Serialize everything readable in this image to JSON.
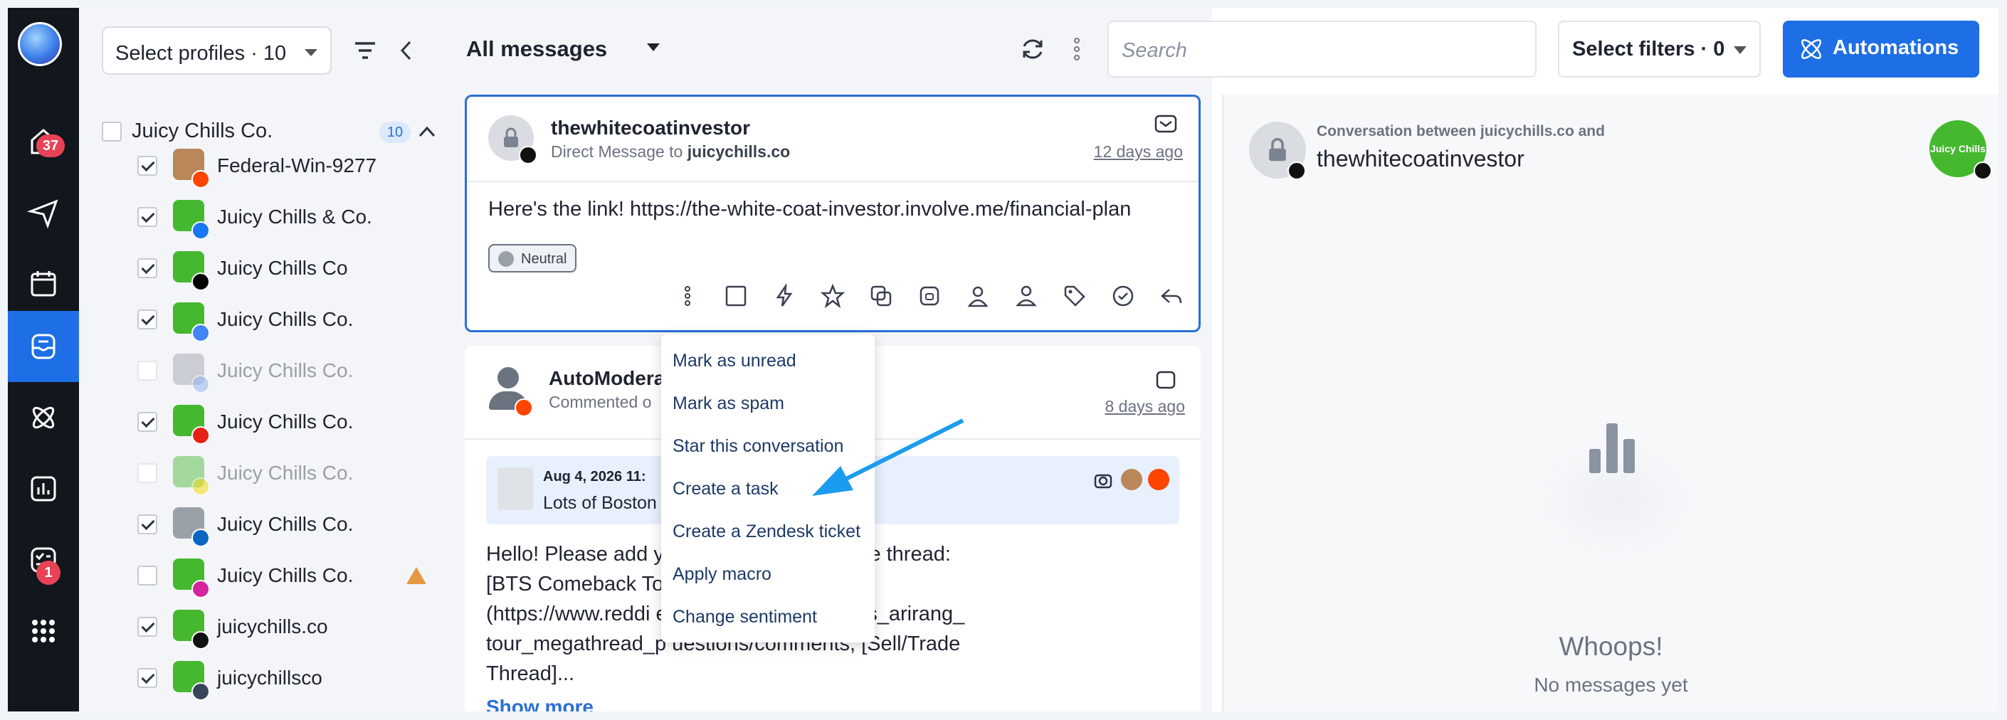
{
  "rail": {
    "badge_inbox_home": "37",
    "badge_tasks": "1"
  },
  "profiles": {
    "select_label": "Select profiles · 10",
    "group_name": "Juicy Chills Co.",
    "group_count": "10",
    "items": [
      {
        "name": "Federal-Win-9277",
        "net": "reddit",
        "checked": true,
        "dim": false
      },
      {
        "name": "Juicy Chills & Co.",
        "net": "facebook",
        "checked": true,
        "dim": false
      },
      {
        "name": "Juicy Chills Co",
        "net": "x",
        "checked": true,
        "dim": false
      },
      {
        "name": "Juicy Chills Co.",
        "net": "gbp",
        "checked": true,
        "dim": false
      },
      {
        "name": "Juicy Chills Co.",
        "net": "gbp-building",
        "checked": false,
        "dim": true
      },
      {
        "name": "Juicy Chills Co.",
        "net": "youtube",
        "checked": true,
        "dim": false
      },
      {
        "name": "Juicy Chills Co.",
        "net": "snapchat",
        "checked": false,
        "dim": true
      },
      {
        "name": "Juicy Chills Co.",
        "net": "linkedin",
        "checked": true,
        "dim": false
      },
      {
        "name": "Juicy Chills Co.",
        "net": "instagram",
        "checked": false,
        "dim": false
      },
      {
        "name": "juicychills.co",
        "net": "tiktok",
        "checked": true,
        "dim": false
      },
      {
        "name": "juicychillsco",
        "net": "tumblr",
        "checked": true,
        "dim": false
      }
    ]
  },
  "center": {
    "title": "All messages"
  },
  "toolbar": {
    "search_placeholder": "Search",
    "filters_label": "Select filters · 0",
    "automations_label": "Automations"
  },
  "card1": {
    "user": "thewhitecoatinvestor",
    "subtitle_prefix": "Direct Message to",
    "subtitle_target": "juicychills.co",
    "date": "12 days ago",
    "text": "Here's the link! https://the-white-coat-investor.involve.me/financial-plan",
    "sentiment": "Neutral"
  },
  "card2": {
    "user": "AutoModera",
    "subtitle": "Commented o",
    "date": "8 days ago",
    "quote_date": "Aug 4, 2026 11:",
    "quote_text": "Lots of Boston                              ster has tons ...",
    "lines": [
      "Hello! Please add y                              stion to the appropriate thread:",
      "[BTS Comeback To",
      "(https://www.reddi                              ents/1tkbrpt/202627_bts_arirang_",
      "tour_megathread_p                              uestions/comments, [Sell/Trade",
      "Thread]..."
    ],
    "show_more": "Show more"
  },
  "menu": {
    "items": [
      "Mark as unread",
      "Mark as spam",
      "Star this conversation",
      "Create a task",
      "Create a Zendesk ticket",
      "Apply macro",
      "Change sentiment"
    ]
  },
  "right": {
    "subtitle": "Conversation between juicychills.co and",
    "name": "thewhitecoatinvestor",
    "brand_label": "Juicy Chills",
    "empty_title": "Whoops!",
    "empty_sub": "No messages yet"
  },
  "colors": {
    "accent": "#1e6fe6",
    "rail": "#12161d",
    "brand_green": "#45b82f",
    "arrow": "#1a9cf0"
  }
}
